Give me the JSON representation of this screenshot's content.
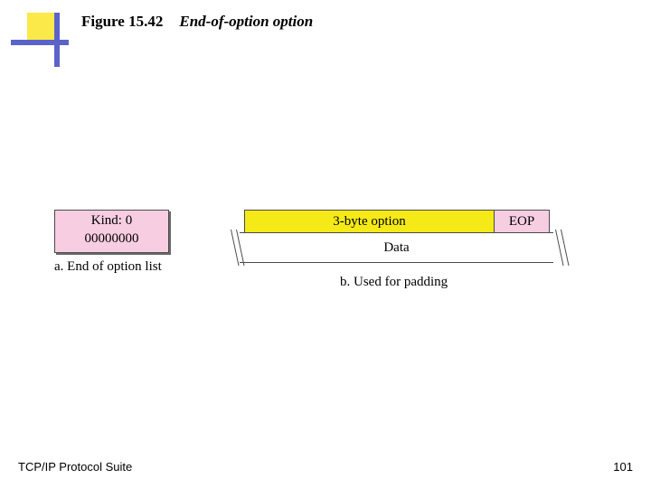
{
  "title": {
    "figure": "Figure 15.42",
    "caption": "End-of-option option"
  },
  "panel_a": {
    "kind_label": "Kind: 0",
    "kind_bits": "00000000",
    "caption": "a. End of option list"
  },
  "panel_b": {
    "option_label": "3-byte option",
    "eop_label": "EOP",
    "data_label": "Data",
    "caption": "b. Used for padding"
  },
  "footer": {
    "left": "TCP/IP Protocol Suite",
    "page": "101"
  }
}
